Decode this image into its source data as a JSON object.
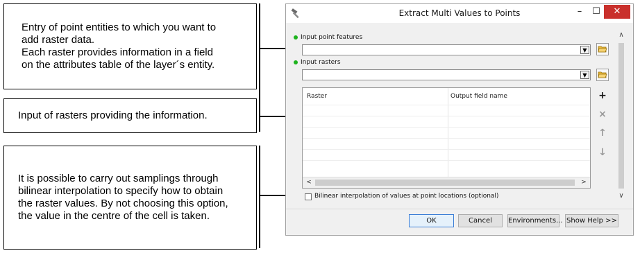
{
  "callouts": [
    {
      "text": "Entry of point entities to which you want to\nadd raster data.\nEach raster provides information in a field\non the attributes table of the layer´s entity."
    },
    {
      "text": "Input of rasters providing the information."
    },
    {
      "text": "It is possible to carry out samplings through\nbilinear interpolation to specify how to obtain\nthe raster values. By not choosing this option,\nthe value in the centre of the cell is taken."
    }
  ],
  "dialog": {
    "title": "Extract Multi Values to Points",
    "window_buttons": {
      "minimize": "–",
      "maximize": "☐",
      "close": "✕"
    },
    "input_point_label": "Input point features",
    "input_point_value": "",
    "input_rasters_label": "Input rasters",
    "input_rasters_value": "",
    "table": {
      "columns": [
        "Raster",
        "Output field name"
      ],
      "rows": []
    },
    "side_buttons": {
      "add": "+",
      "remove": "×",
      "up": "↑",
      "down": "↓"
    },
    "checkbox_label": "Bilinear interpolation of values at point locations (optional)",
    "checkbox_checked": false,
    "buttons": {
      "ok": "OK",
      "cancel": "Cancel",
      "environments": "Environments...",
      "show_help": "Show Help >>"
    }
  },
  "colors": {
    "required_dot": "#1db31d",
    "close_button": "#c9302c"
  }
}
